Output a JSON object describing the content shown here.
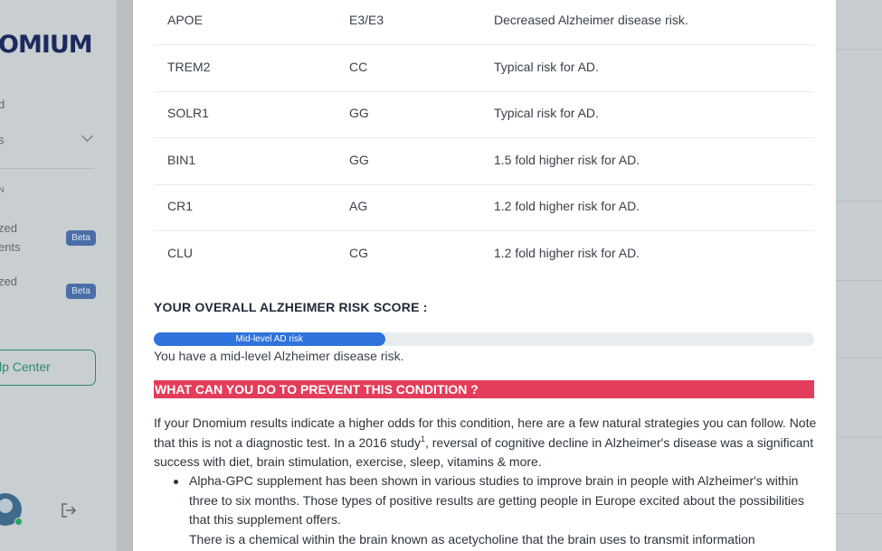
{
  "sidebar": {
    "logo_text": "OMIUM",
    "items": [
      {
        "label": "d"
      },
      {
        "label": "s"
      },
      {
        "label": "N"
      },
      {
        "label": "zed"
      },
      {
        "label": "ents"
      },
      {
        "label": "zed"
      }
    ],
    "beta_label": "Beta",
    "help_button": "lp Center"
  },
  "table": {
    "rows": [
      {
        "gene": "APOE",
        "genotype": "E3/E3",
        "description": "Decreased Alzheimer disease risk."
      },
      {
        "gene": "TREM2",
        "genotype": "CC",
        "description": "Typical risk for AD."
      },
      {
        "gene": "SOLR1",
        "genotype": "GG",
        "description": "Typical risk for AD."
      },
      {
        "gene": "BIN1",
        "genotype": "GG",
        "description": "1.5 fold higher risk for AD."
      },
      {
        "gene": "CR1",
        "genotype": "AG",
        "description": "1.2 fold higher risk for AD."
      },
      {
        "gene": "CLU",
        "genotype": "CG",
        "description": "1.2 fold higher risk for AD."
      }
    ]
  },
  "score": {
    "title": "YOUR OVERALL ALZHEIMER RISK SCORE :",
    "bar_label": "Mid-level AD risk",
    "bar_fraction": 0.35,
    "summary": "You have a mid-level Alzheimer disease risk."
  },
  "prevention": {
    "header": "WHAT CAN YOU DO TO PREVENT THIS CONDITION ?",
    "intro_part1": "If your Dnomium results indicate a higher odds for this condition, here are a few natural strategies you can follow. Note that this is not a diagnostic test. In a 2016 study",
    "intro_sup": "1",
    "intro_part2": ", reversal of cognitive decline in Alzheimer's disease was a significant success with diet, brain stimulation, exercise, sleep, vitamins & more.",
    "bullet1": "Alpha-GPC supplement has been shown in various studies to improve brain in people with Alzheimer's within three to six months. Those types of positive results are getting people in Europe excited about the possibilities that this supplement offers.",
    "bullet1_cont": "There is a chemical within the brain known as acetycholine that the brain uses to transmit information"
  },
  "colors": {
    "accent_blue": "#2f73dc",
    "header_red": "#e33d5b",
    "help_green": "#2c8a70"
  },
  "icons": [
    "chevron-down-icon",
    "logout-icon"
  ]
}
